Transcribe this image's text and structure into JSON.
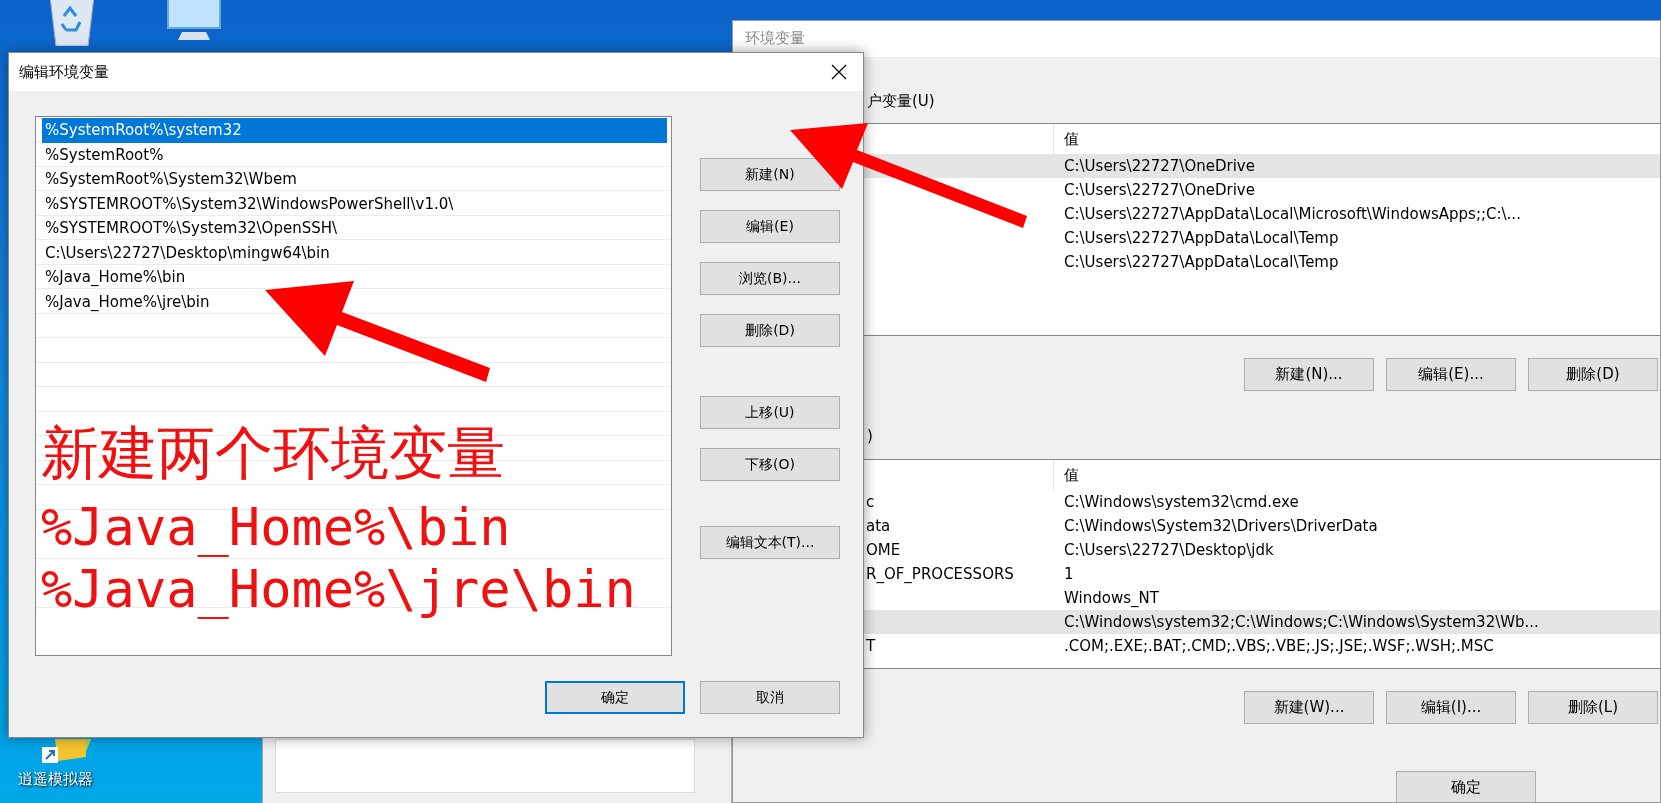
{
  "desktop": {
    "shortcut": {
      "label": "逍遥模拟器"
    }
  },
  "env_window": {
    "title": "环境变量",
    "user_vars": {
      "label": "户变量(U)",
      "value_header": "值",
      "rows": [
        {
          "value": "C:\\Users\\22727\\OneDrive",
          "selected": true
        },
        {
          "value": "C:\\Users\\22727\\OneDrive",
          "selected": false
        },
        {
          "value": "C:\\Users\\22727\\AppData\\Local\\Microsoft\\WindowsApps;;C:\\...",
          "selected": false
        },
        {
          "value": "C:\\Users\\22727\\AppData\\Local\\Temp",
          "selected": false
        },
        {
          "value": "C:\\Users\\22727\\AppData\\Local\\Temp",
          "selected": false
        }
      ],
      "buttons": [
        "新建(N)...",
        "编辑(E)...",
        "删除(D)"
      ]
    },
    "system_vars": {
      "label": ")",
      "value_header": "值",
      "rows": [
        {
          "name": "c",
          "value": "C:\\Windows\\system32\\cmd.exe",
          "selected": false
        },
        {
          "name": "ata",
          "value": "C:\\Windows\\System32\\Drivers\\DriverData",
          "selected": false
        },
        {
          "name": "OME",
          "value": "C:\\Users\\22727\\Desktop\\jdk",
          "selected": false
        },
        {
          "name": "R_OF_PROCESSORS",
          "value": "1",
          "selected": false
        },
        {
          "value": "Windows_NT",
          "selected": false
        },
        {
          "value": "C:\\Windows\\system32;C:\\Windows;C:\\Windows\\System32\\Wb...",
          "selected": true
        },
        {
          "name": "T",
          "value": ".COM;.EXE;.BAT;.CMD;.VBS;.VBE;.JS;.JSE;.WSF;.WSH;.MSC",
          "selected": false
        }
      ],
      "buttons": [
        "新建(W)...",
        "编辑(I)...",
        "删除(L)"
      ]
    },
    "footer_buttons": [
      "确定"
    ]
  },
  "edit_dialog": {
    "title": "编辑环境变量",
    "items": [
      {
        "text": "%SystemRoot%\\system32",
        "selected": true
      },
      {
        "text": "%SystemRoot%",
        "selected": false
      },
      {
        "text": "%SystemRoot%\\System32\\Wbem",
        "selected": false
      },
      {
        "text": "%SYSTEMROOT%\\System32\\WindowsPowerShell\\v1.0\\",
        "selected": false
      },
      {
        "text": "%SYSTEMROOT%\\System32\\OpenSSH\\",
        "selected": false
      },
      {
        "text": "C:\\Users\\22727\\Desktop\\mingw64\\bin",
        "selected": false
      },
      {
        "text": "%Java_Home%\\bin",
        "selected": false
      },
      {
        "text": "%Java_Home%\\jre\\bin",
        "selected": false
      }
    ],
    "side_buttons": [
      [
        "新建(N)",
        "编辑(E)",
        "浏览(B)...",
        "删除(D)"
      ],
      [
        "上移(U)",
        "下移(O)"
      ],
      [
        "编辑文本(T)..."
      ]
    ],
    "footer_buttons": [
      {
        "label": "确定",
        "default": true
      },
      {
        "label": "取消",
        "default": false
      }
    ],
    "annotation": {
      "note": "新建两个环境变量",
      "lines": [
        "%Java_Home%\\bin",
        "%Java_Home%\\jre\\bin"
      ]
    }
  }
}
